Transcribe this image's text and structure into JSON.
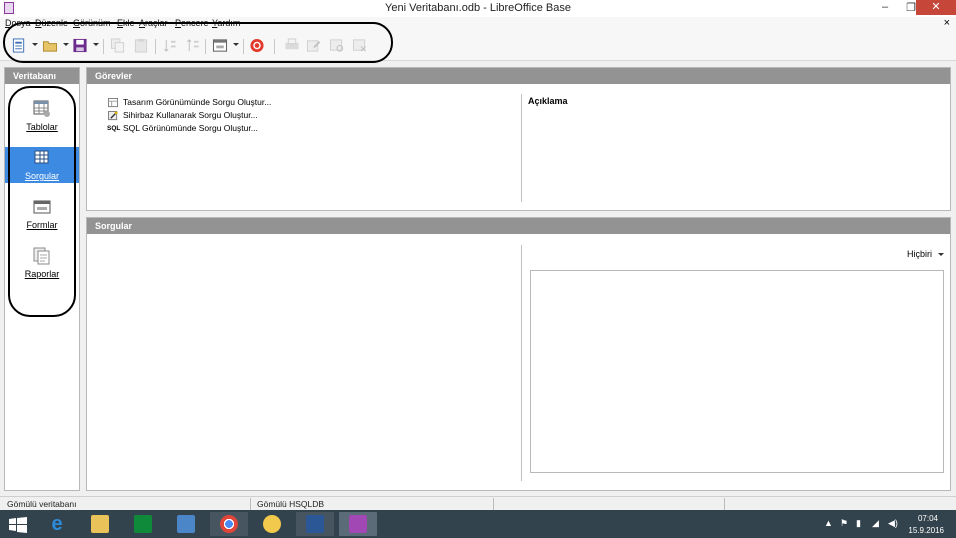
{
  "window": {
    "title": "Yeni Veritabanı.odb - LibreOffice Base",
    "minimize": "‒",
    "restore": "❐",
    "close": "✕"
  },
  "menubar": {
    "items": [
      "Dosya",
      "Düzenle",
      "Görünüm",
      "Ekle",
      "Araçlar",
      "Pencere",
      "Yardım"
    ],
    "doc_close": "×"
  },
  "toolbar": {
    "buttons": [
      "new-icon",
      "open-icon",
      "save-icon",
      "copy-icon",
      "paste-icon",
      "sort-ascending-icon",
      "sort-descending-icon",
      "form-icon",
      "help-icon",
      "print-icon",
      "edit-icon",
      "query-icon",
      "delete-icon"
    ]
  },
  "database_panel": {
    "header": "Veritabanı",
    "items": [
      {
        "label": "Tablolar",
        "icon": "tables-icon",
        "selected": false
      },
      {
        "label": "Sorgular",
        "icon": "queries-icon",
        "selected": true
      },
      {
        "label": "Formlar",
        "icon": "forms-icon",
        "selected": false
      },
      {
        "label": "Raporlar",
        "icon": "reports-icon",
        "selected": false
      }
    ]
  },
  "tasks": {
    "header": "Görevler",
    "items": [
      {
        "label": "Tasarım Görünümünde Sorgu Oluştur...",
        "icon": "design-view-icon"
      },
      {
        "label": "Sihirbaz Kullanarak Sorgu Oluştur...",
        "icon": "wizard-icon"
      },
      {
        "label": "SQL Görünümünde Sorgu Oluştur...",
        "icon": "sql-icon",
        "icon_text": "SQL"
      }
    ],
    "description_header": "Açıklama"
  },
  "queries": {
    "header": "Sorgular",
    "preview_select": "Hiçbiri"
  },
  "statusbar": {
    "left": "Gömülü veritabanı",
    "middle": "Gömülü HSQLDB"
  },
  "taskbar": {
    "apps": [
      "start-icon",
      "internet-explorer-icon",
      "file-explorer-icon",
      "store-icon",
      "control-panel-icon",
      "chrome-icon",
      "paint-icon",
      "word-icon",
      "libreoffice-base-icon"
    ],
    "time": "07:04",
    "date": "15.9.2016"
  },
  "colors": {
    "selection": "#3d8ae3",
    "panel_header": "#939393",
    "taskbar": "#33434d"
  }
}
